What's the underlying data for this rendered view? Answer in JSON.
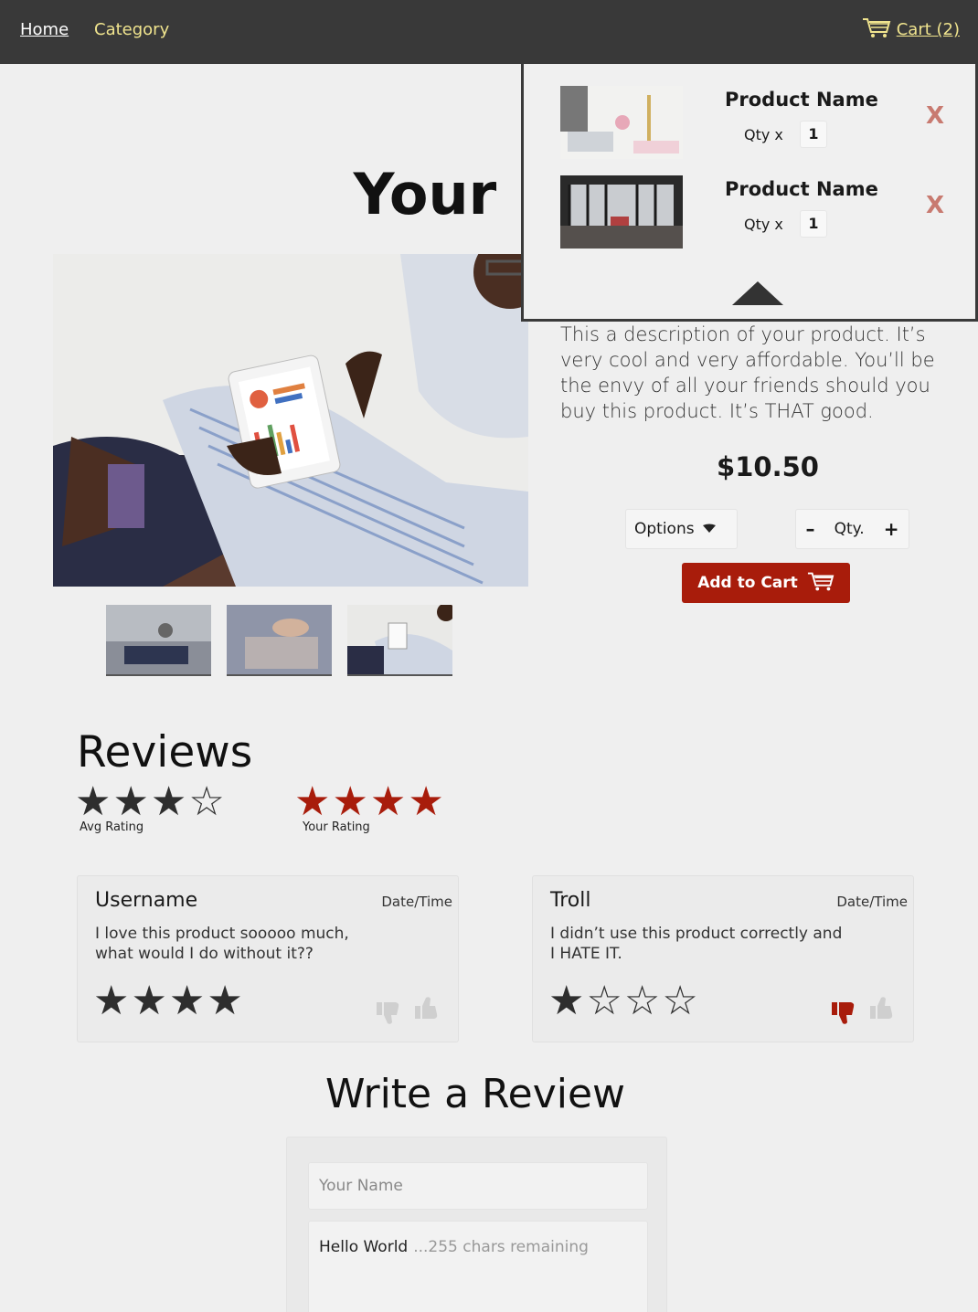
{
  "nav": {
    "home": "Home",
    "category": "Category",
    "cart": "Cart (2)"
  },
  "product": {
    "title": "Your Pro",
    "description": "This a description of your product. It’s very cool and very affordable. You’ll be the envy of all your friends should you buy this product. It’s THAT good.",
    "price": "$10.50",
    "options_label": "Options",
    "qty_label": "Qty.",
    "add_to_cart": "Add to Cart"
  },
  "cart_dropdown": {
    "items": [
      {
        "name": "Product Name",
        "qty_label": "Qty x",
        "qty": "1",
        "remove": "X"
      },
      {
        "name": "Product Name",
        "qty_label": "Qty x",
        "qty": "1",
        "remove": "X"
      }
    ]
  },
  "reviews": {
    "heading": "Reviews",
    "avg_label": "Avg Rating",
    "avg_rating": 3,
    "your_label": "Your Rating",
    "your_rating": 4,
    "list": [
      {
        "username": "Username",
        "datetime": "Date/Time",
        "body": "I love this product sooooo much, what would I do without it??",
        "rating": 4,
        "vote": "none"
      },
      {
        "username": "Troll",
        "datetime": "Date/Time",
        "body": "I didn’t use this product correctly and I HATE IT.",
        "rating": 1,
        "vote": "down"
      }
    ]
  },
  "write_review": {
    "heading": "Write a Review",
    "name_placeholder": "Your Name",
    "message": "Hello World",
    "remaining": "...255 chars remaining"
  },
  "colors": {
    "nav_bg": "#393939",
    "nav_link": "#f0e48e",
    "accent": "#a81c0b",
    "remove": "#c87a70"
  }
}
